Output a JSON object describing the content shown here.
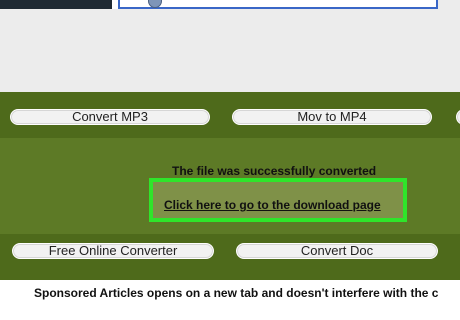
{
  "nav_buttons_top": [
    "Convert MP3",
    "Mov to MP4"
  ],
  "nav_buttons_bottom": [
    "Free Online Converter",
    "Convert Doc"
  ],
  "result": {
    "message": "The file was successfully converted",
    "download_link": "Click here to go to the download page"
  },
  "footer": {
    "text": "Sponsored Articles opens on a new tab and doesn't interfere with the c"
  },
  "colors": {
    "bar_green": "#5d7a26",
    "bar_dark": "#4e6a1b",
    "highlight_border": "#2fe52a"
  }
}
